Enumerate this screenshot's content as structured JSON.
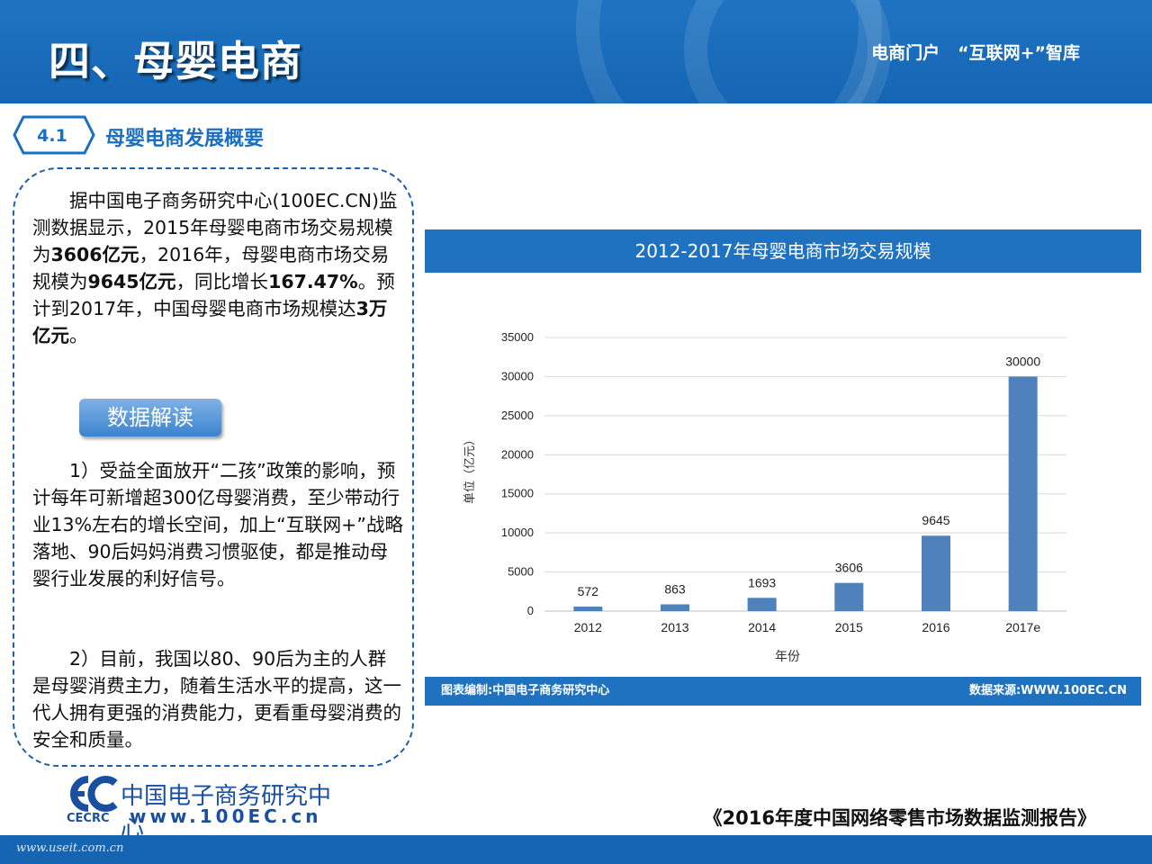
{
  "header": {
    "title": "四、母婴电商",
    "portal": "电商门户",
    "think_tank": "“互联网+”智库"
  },
  "section": {
    "number": "4.1",
    "title": "母婴电商发展概要"
  },
  "text": {
    "p1_a": "据中国电子商务研究中心(100EC.CN)监测数据显示，2015年母婴电商市场交易规模为",
    "p1_b": "3606亿元",
    "p1_c": "，2016年，母婴电商市场交易规模为",
    "p1_d": "9645亿元",
    "p1_e": "，同比增长",
    "p1_f": "167.47%",
    "p1_g": "。预计到2017年，中国母婴电商市场规模达",
    "p1_h": "3万亿元",
    "p1_i": "。",
    "pill": "数据解读",
    "p2": "1）受益全面放开“二孩”政策的影响，预计每年可新增超300亿母婴消费，至少带动行业13%左右的增长空间，加上“互联网+”战略落地、90后妈妈消费习惯驱使，都是推动母婴行业发展的利好信号。",
    "p3": "2）目前，我国以80、90后为主的人群是母婴消费主力，随着生活水平的提高，这一代人拥有更强的消费能力，更看重母婴消费的安全和质量。"
  },
  "chart_data": {
    "type": "bar",
    "title": "2012-2017年母婴电商市场交易规模",
    "categories": [
      "2012",
      "2013",
      "2014",
      "2015",
      "2016",
      "2017e"
    ],
    "values": [
      572,
      863,
      1693,
      3606,
      9645,
      30000
    ],
    "xlabel": "年份",
    "ylabel": "单位（亿元）",
    "ylim": [
      0,
      35000
    ],
    "yticks": [
      0,
      5000,
      10000,
      15000,
      20000,
      25000,
      30000,
      35000
    ],
    "grid": true,
    "bar_color": "#4f81bd",
    "credit_left": "图表编制:中国电子商务研究中心",
    "credit_right": "数据来源:WWW.100EC.CN"
  },
  "logo": {
    "abbr": "CECRC",
    "name": "中国电子商务研究中心",
    "url": "www.100EC.cn"
  },
  "report_title": "《2016年度中国网络零售市场数据监测报告》",
  "footer_url": "www.useit.com.cn",
  "colors": {
    "primary_blue": "#1f72c0",
    "accent_blue": "#1a6fc0",
    "bar": "#4f81bd"
  }
}
